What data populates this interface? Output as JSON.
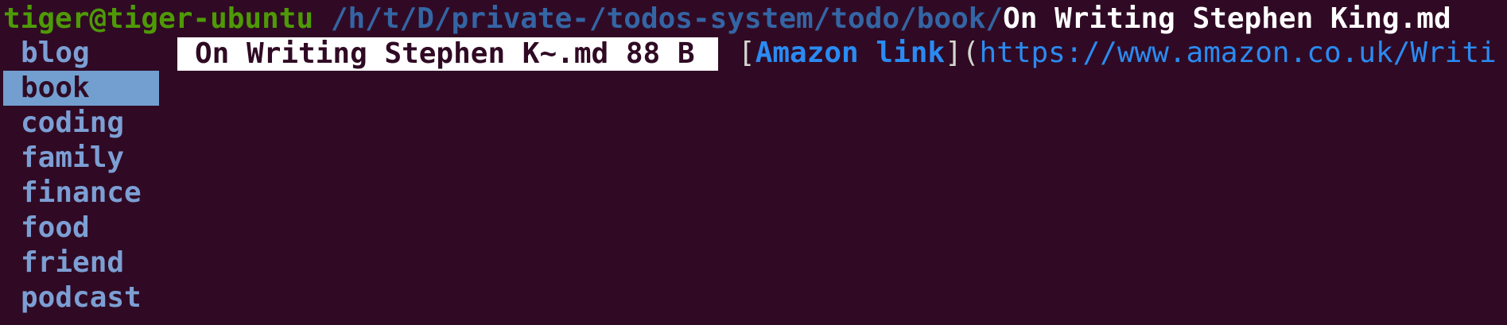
{
  "prompt": {
    "user_host": "tiger@tiger-ubuntu",
    "path": "/h/t/D/private-/todos-system/todo/book/",
    "filename": "On Writing Stephen King.md"
  },
  "sidebar": {
    "items": [
      {
        "label": "blog",
        "selected": false
      },
      {
        "label": "book",
        "selected": true
      },
      {
        "label": "coding",
        "selected": false
      },
      {
        "label": "family",
        "selected": false
      },
      {
        "label": "finance",
        "selected": false
      },
      {
        "label": "food",
        "selected": false
      },
      {
        "label": "friend",
        "selected": false
      },
      {
        "label": "podcast",
        "selected": false
      }
    ]
  },
  "file_list": {
    "entry": "On Writing Stephen K~.md 88 B"
  },
  "preview": {
    "open_bracket": "[",
    "link_text": "Amazon link",
    "close_bracket_paren": "](",
    "url": "https://www.amazon.co.uk/Writi"
  },
  "colors": {
    "background": "#300a24",
    "user_host": "#4e9a06",
    "path": "#3465a4",
    "selection": "#729fcf",
    "link": "#2a8bf2"
  }
}
